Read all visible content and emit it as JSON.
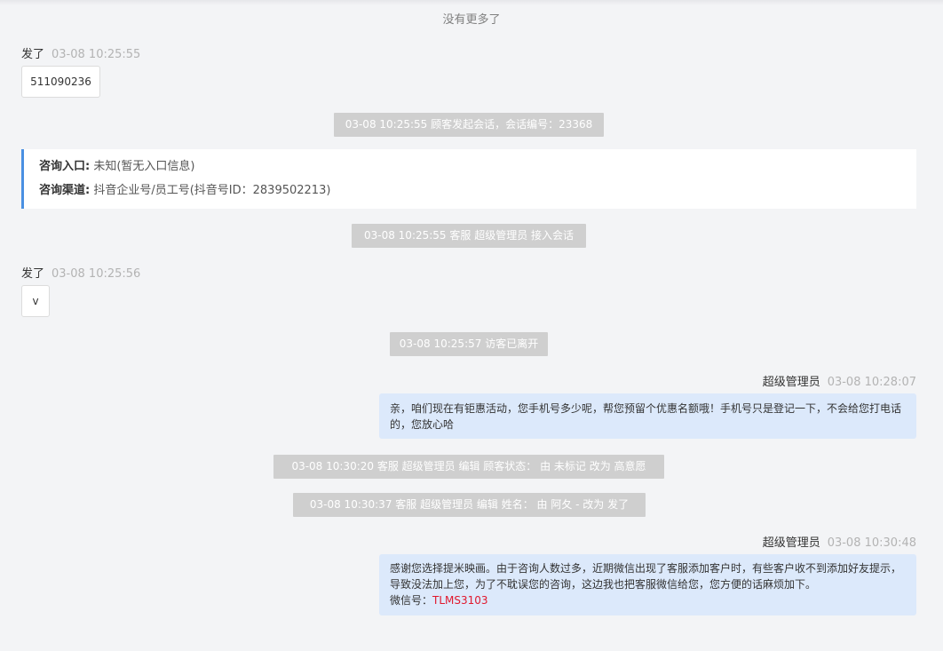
{
  "header": {
    "no_more": "没有更多了"
  },
  "messages": {
    "m1": {
      "sender": "发了",
      "time": "03-08 10:25:55",
      "text": "511090236"
    },
    "m2": {
      "sender": "发了",
      "time": "03-08 10:25:56",
      "text": "v"
    },
    "m3": {
      "sender": "超级管理员",
      "time": "03-08 10:28:07",
      "text": "亲，咱们现在有钜惠活动，您手机号多少呢，帮您预留个优惠名额哦！手机号只是登记一下，不会给您打电话的，您放心哈"
    },
    "m4": {
      "sender": "超级管理员",
      "time": "03-08 10:30:48",
      "text": "感谢您选择提米映画。由于咨询人数过多，近期微信出现了客服添加客户时，有些客户收不到添加好友提示，导致没法加上您，为了不耽误您的咨询，这边我也把客服微信给您，您方便的话麻烦加下。",
      "wechat_label": "微信号：",
      "wechat_id": "TLMS3103"
    }
  },
  "system": {
    "s1": "03-08 10:25:55 顾客发起会话，会话编号：23368",
    "s2": "03-08 10:25:55 客服 超级管理员 接入会话",
    "s3": "03-08 10:25:57 访客已离开",
    "s4": "03-08 10:30:20 客服 超级管理员 编辑 顾客状态： 由 未标记 改为 高意愿",
    "s5": "03-08 10:30:37 客服 超级管理员 编辑 姓名： 由 阿夂 - 改为 发了"
  },
  "info": {
    "entry_label": "咨询入口:",
    "entry_value": "未知(暂无入口信息)",
    "channel_label": "咨询渠道:",
    "channel_value": "抖音企业号/员工号(抖音号ID：2839502213)"
  },
  "colors": {
    "background": "#f3f4f6",
    "agent_bubble": "#dce9fb",
    "system_pill": "#cfcfcf",
    "info_accent": "#4a90e2",
    "wechat_id": "#e0182d"
  }
}
